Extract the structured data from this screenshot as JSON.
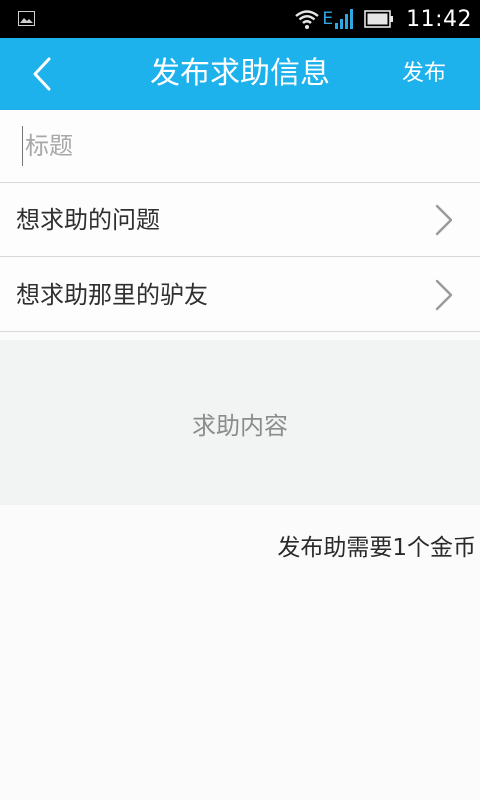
{
  "status_bar": {
    "network_type": "E",
    "time": "11:42"
  },
  "header": {
    "title": "发布求助信息",
    "publish_label": "发布"
  },
  "form": {
    "title_placeholder": "标题",
    "question_label": "想求助的问题",
    "target_label": "想求助那里的驴友",
    "content_placeholder": "求助内容",
    "coin_note": "发布助需要1个金币"
  },
  "colors": {
    "accent": "#1eb2ec",
    "content_bg": "#f2f3f3",
    "divider": "#d8d8d8"
  },
  "icons": {
    "back": "chevron-left-icon",
    "row_arrow": "chevron-right-icon"
  }
}
